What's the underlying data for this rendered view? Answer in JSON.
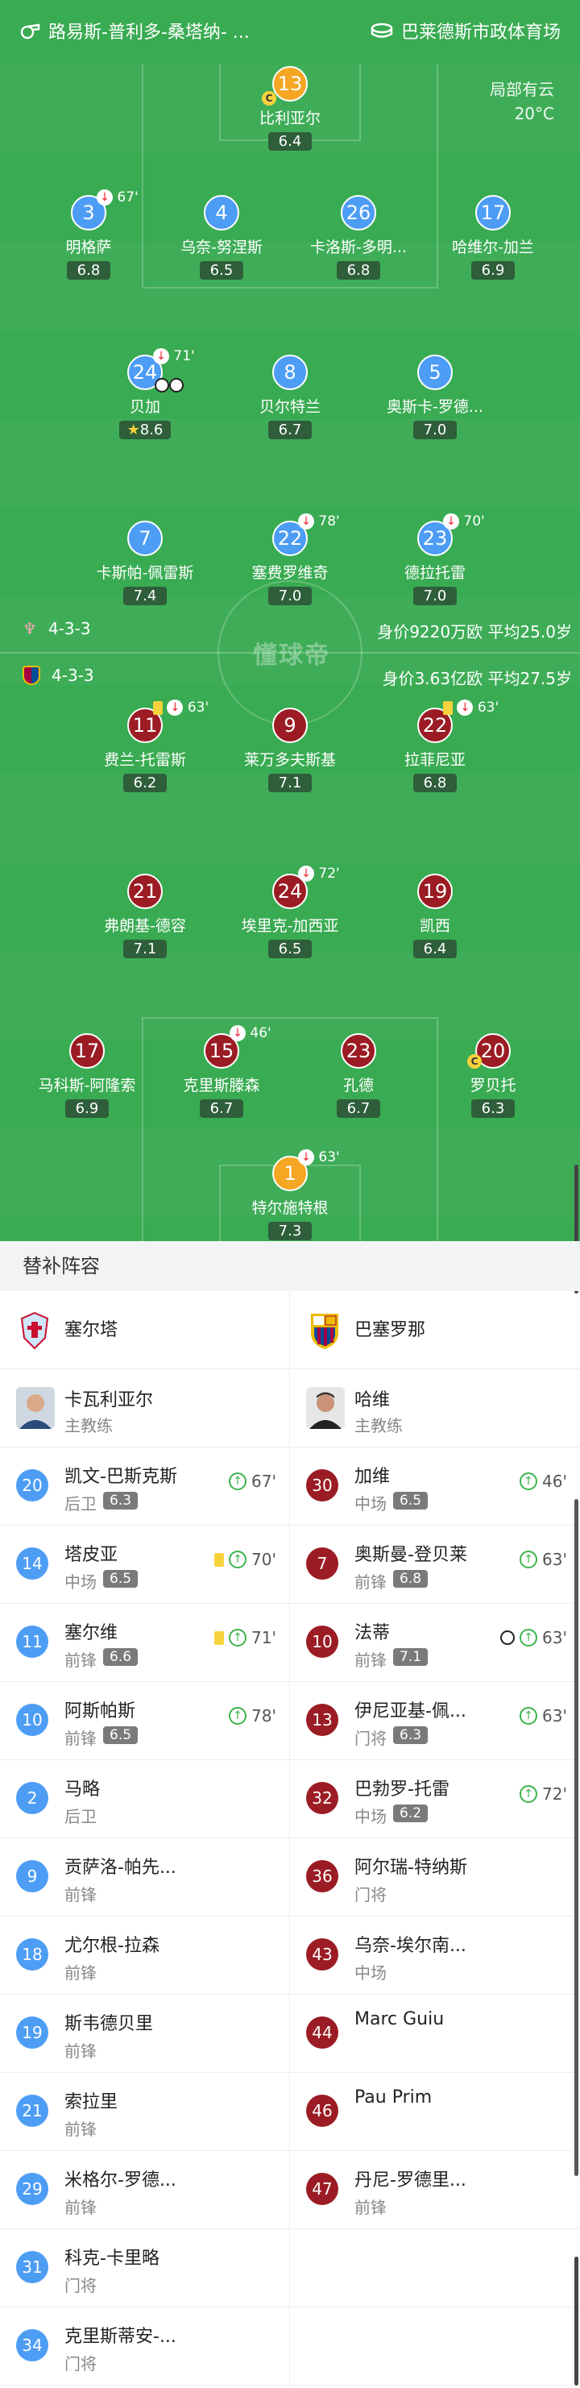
{
  "header": {
    "referee": "路易斯-普利多-桑塔纳- ...",
    "venue": "巴莱德斯市政体育场"
  },
  "weather": {
    "condition": "局部有云",
    "temperature": "20°C"
  },
  "home_team": {
    "formation": "4-3-3",
    "value": "身价9220万欧 平均25.0岁"
  },
  "away_team": {
    "formation": "4-3-3",
    "value": "身价3.63亿欧 平均27.5岁"
  },
  "watermark": "懂球帝",
  "home_players": [
    {
      "num": "13",
      "name": "比利亚尔",
      "rating": "6.4",
      "color": "gold"
    },
    {
      "num": "3",
      "name": "明格萨",
      "rating": "6.8",
      "color": "blue",
      "sub": "67'"
    },
    {
      "num": "4",
      "name": "乌奈-努涅斯",
      "rating": "6.5",
      "color": "blue"
    },
    {
      "num": "26",
      "name": "卡洛斯-多明...",
      "rating": "6.8",
      "color": "blue"
    },
    {
      "num": "17",
      "name": "哈维尔-加兰",
      "rating": "6.9",
      "color": "blue"
    },
    {
      "num": "24",
      "name": "贝加",
      "rating": "8.6",
      "color": "blue",
      "sub": "71'"
    },
    {
      "num": "8",
      "name": "贝尔特兰",
      "rating": "6.7",
      "color": "blue"
    },
    {
      "num": "5",
      "name": "奥斯卡-罗德...",
      "rating": "7.0",
      "color": "blue"
    },
    {
      "num": "7",
      "name": "卡斯帕-佩雷斯",
      "rating": "7.4",
      "color": "blue"
    },
    {
      "num": "22",
      "name": "塞费罗维奇",
      "rating": "7.0",
      "color": "blue",
      "sub": "78'"
    },
    {
      "num": "23",
      "name": "德拉托雷",
      "rating": "7.0",
      "color": "blue",
      "sub": "70'"
    }
  ],
  "away_players": [
    {
      "num": "11",
      "name": "费兰-托雷斯",
      "rating": "6.2",
      "sub": "63'"
    },
    {
      "num": "9",
      "name": "莱万多夫斯基",
      "rating": "7.1"
    },
    {
      "num": "22",
      "name": "拉菲尼亚",
      "rating": "6.8",
      "sub": "63'"
    },
    {
      "num": "21",
      "name": "弗朗基-德容",
      "rating": "7.1"
    },
    {
      "num": "24",
      "name": "埃里克-加西亚",
      "rating": "6.5",
      "sub": "72'"
    },
    {
      "num": "19",
      "name": "凯西",
      "rating": "6.4"
    },
    {
      "num": "17",
      "name": "马科斯-阿隆索",
      "rating": "6.9"
    },
    {
      "num": "15",
      "name": "克里斯滕森",
      "rating": "6.7",
      "sub": "46'"
    },
    {
      "num": "23",
      "name": "孔德",
      "rating": "6.7"
    },
    {
      "num": "20",
      "name": "罗贝托",
      "rating": "6.3"
    },
    {
      "num": "1",
      "name": "特尔施特根",
      "rating": "7.3",
      "color": "gold",
      "sub": "63'"
    }
  ],
  "subs": {
    "title": "替补阵容",
    "home_name": "塞尔塔",
    "away_name": "巴塞罗那",
    "home_coach": {
      "name": "卡瓦利亚尔",
      "role": "主教练"
    },
    "away_coach": {
      "name": "哈维",
      "role": "主教练"
    },
    "rows": [
      [
        {
          "num": "20",
          "name": "凯文-巴斯克斯",
          "pos": "后卫",
          "rating": "6.3",
          "on": "67'"
        },
        {
          "num": "30",
          "name": "加维",
          "pos": "中场",
          "rating": "6.5",
          "on": "46'"
        }
      ],
      [
        {
          "num": "14",
          "name": "塔皮亚",
          "pos": "中场",
          "rating": "6.5",
          "on": "70'",
          "card": true
        },
        {
          "num": "7",
          "name": "奥斯曼-登贝莱",
          "pos": "前锋",
          "rating": "6.8",
          "on": "63'"
        }
      ],
      [
        {
          "num": "11",
          "name": "塞尔维",
          "pos": "前锋",
          "rating": "6.6",
          "on": "71'",
          "card": true
        },
        {
          "num": "10",
          "name": "法蒂",
          "pos": "前锋",
          "rating": "7.1",
          "on": "63'",
          "goal": true
        }
      ],
      [
        {
          "num": "10",
          "name": "阿斯帕斯",
          "pos": "前锋",
          "rating": "6.5",
          "on": "78'"
        },
        {
          "num": "13",
          "name": "伊尼亚基-佩...",
          "pos": "门将",
          "rating": "6.3",
          "on": "63'"
        }
      ],
      [
        {
          "num": "2",
          "name": "马略",
          "pos": "后卫"
        },
        {
          "num": "32",
          "name": "巴勃罗-托雷",
          "pos": "中场",
          "rating": "6.2",
          "on": "72'"
        }
      ],
      [
        {
          "num": "9",
          "name": "贡萨洛-帕先...",
          "pos": "前锋"
        },
        {
          "num": "36",
          "name": "阿尔瑞-特纳斯",
          "pos": "门将"
        }
      ],
      [
        {
          "num": "18",
          "name": "尤尔根-拉森",
          "pos": "前锋"
        },
        {
          "num": "43",
          "name": "乌奈-埃尔南...",
          "pos": "中场"
        }
      ],
      [
        {
          "num": "19",
          "name": "斯韦德贝里",
          "pos": "前锋"
        },
        {
          "num": "44",
          "name": "Marc Guiu",
          "pos": ""
        }
      ],
      [
        {
          "num": "21",
          "name": "索拉里",
          "pos": "前锋"
        },
        {
          "num": "46",
          "name": "Pau Prim",
          "pos": ""
        }
      ],
      [
        {
          "num": "29",
          "name": "米格尔-罗德...",
          "pos": "前锋"
        },
        {
          "num": "47",
          "name": "丹尼-罗德里...",
          "pos": "前锋"
        }
      ],
      [
        {
          "num": "31",
          "name": "科克-卡里略",
          "pos": "门将"
        },
        null
      ],
      [
        {
          "num": "34",
          "name": "克里斯蒂安-...",
          "pos": "门将"
        },
        null
      ]
    ]
  }
}
